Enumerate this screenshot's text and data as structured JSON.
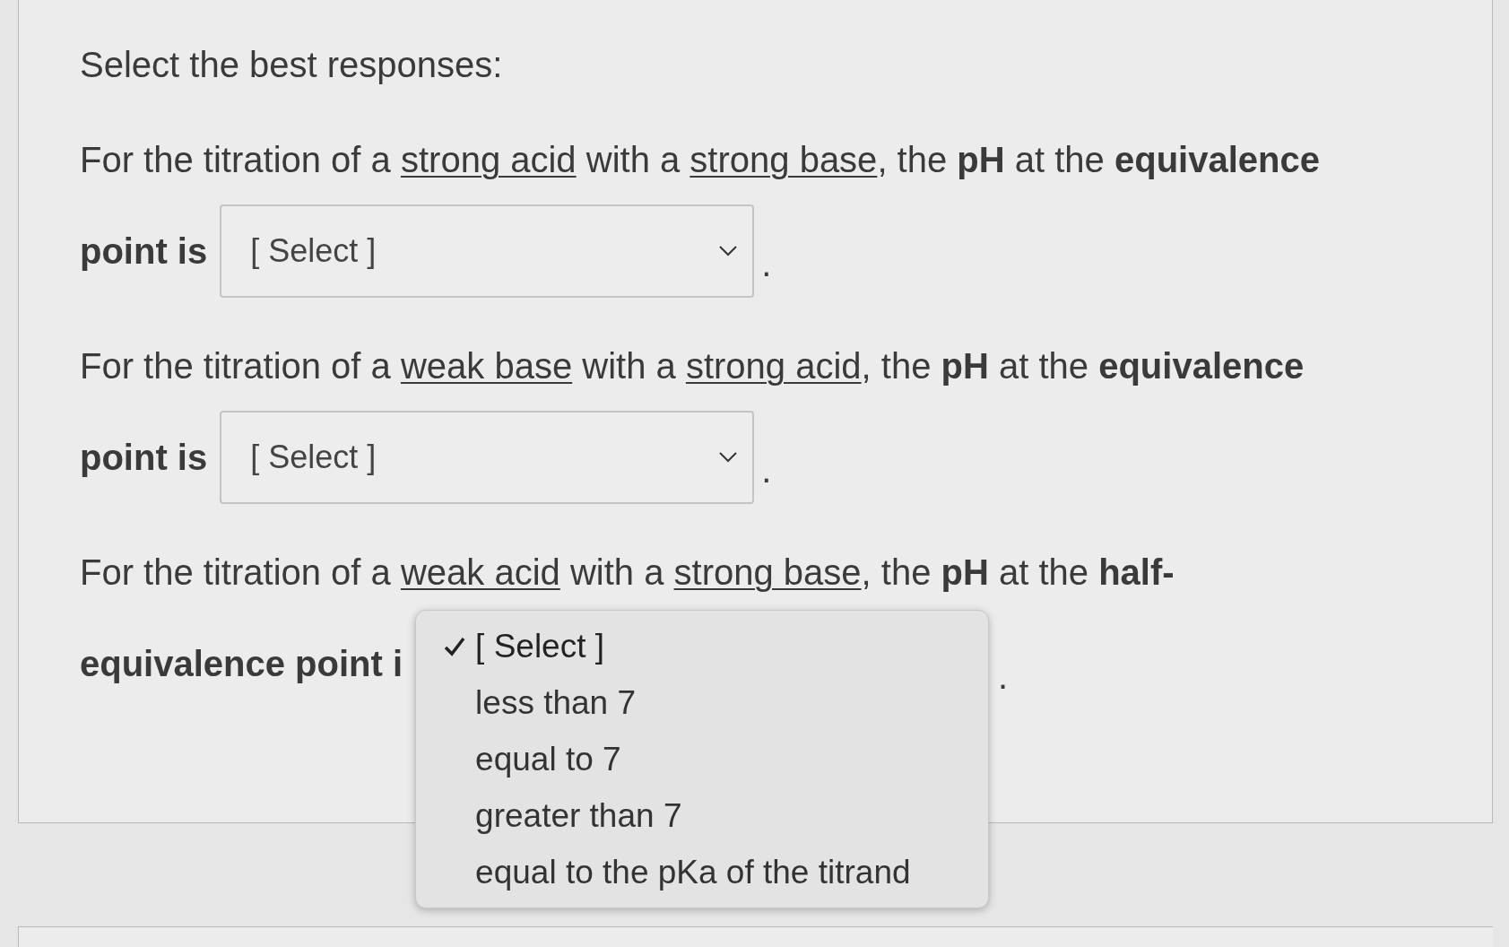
{
  "instruction": "Select the best responses:",
  "questions": [
    {
      "line_1": [
        {
          "kind": "plain",
          "text": "For the titration of a "
        },
        {
          "kind": "underline",
          "text": "strong acid"
        },
        {
          "kind": "plain",
          "text": " with a "
        },
        {
          "kind": "underline",
          "text": "strong base"
        },
        {
          "kind": "plain",
          "text": ", the "
        },
        {
          "kind": "bold",
          "text": "pH"
        },
        {
          "kind": "plain",
          "text": " at the "
        },
        {
          "kind": "bold",
          "text": "equivalence"
        }
      ],
      "line_2": "point is",
      "select": {
        "value": "[ Select ]",
        "expanded": false
      },
      "after": "."
    },
    {
      "line_1": [
        {
          "kind": "plain",
          "text": "For the titration of a "
        },
        {
          "kind": "underline",
          "text": "weak base"
        },
        {
          "kind": "plain",
          "text": " with a "
        },
        {
          "kind": "underline",
          "text": "strong acid"
        },
        {
          "kind": "plain",
          "text": ", the "
        },
        {
          "kind": "bold",
          "text": "pH"
        },
        {
          "kind": "plain",
          "text": " at the "
        },
        {
          "kind": "bold",
          "text": "equivalence"
        }
      ],
      "line_2": "point is",
      "select": {
        "value": "[ Select ]",
        "expanded": false
      },
      "after": "."
    },
    {
      "line_1": [
        {
          "kind": "plain",
          "text": "For the titration of a "
        },
        {
          "kind": "underline",
          "text": "weak acid"
        },
        {
          "kind": "plain",
          "text": " with a "
        },
        {
          "kind": "underline",
          "text": "strong base"
        },
        {
          "kind": "plain",
          "text": ", the "
        },
        {
          "kind": "bold",
          "text": "pH"
        },
        {
          "kind": "plain",
          "text": " at the "
        },
        {
          "kind": "bold",
          "text": "half-"
        }
      ],
      "line_2": "equivalence point i",
      "select": {
        "expanded": true,
        "options": [
          {
            "label": "[ Select ]",
            "selected": true
          },
          {
            "label": "less than 7",
            "selected": false
          },
          {
            "label": "equal to 7",
            "selected": false
          },
          {
            "label": "greater than 7",
            "selected": false
          },
          {
            "label": "equal to the pKa of the titrand",
            "selected": false
          }
        ]
      },
      "after": "."
    }
  ]
}
